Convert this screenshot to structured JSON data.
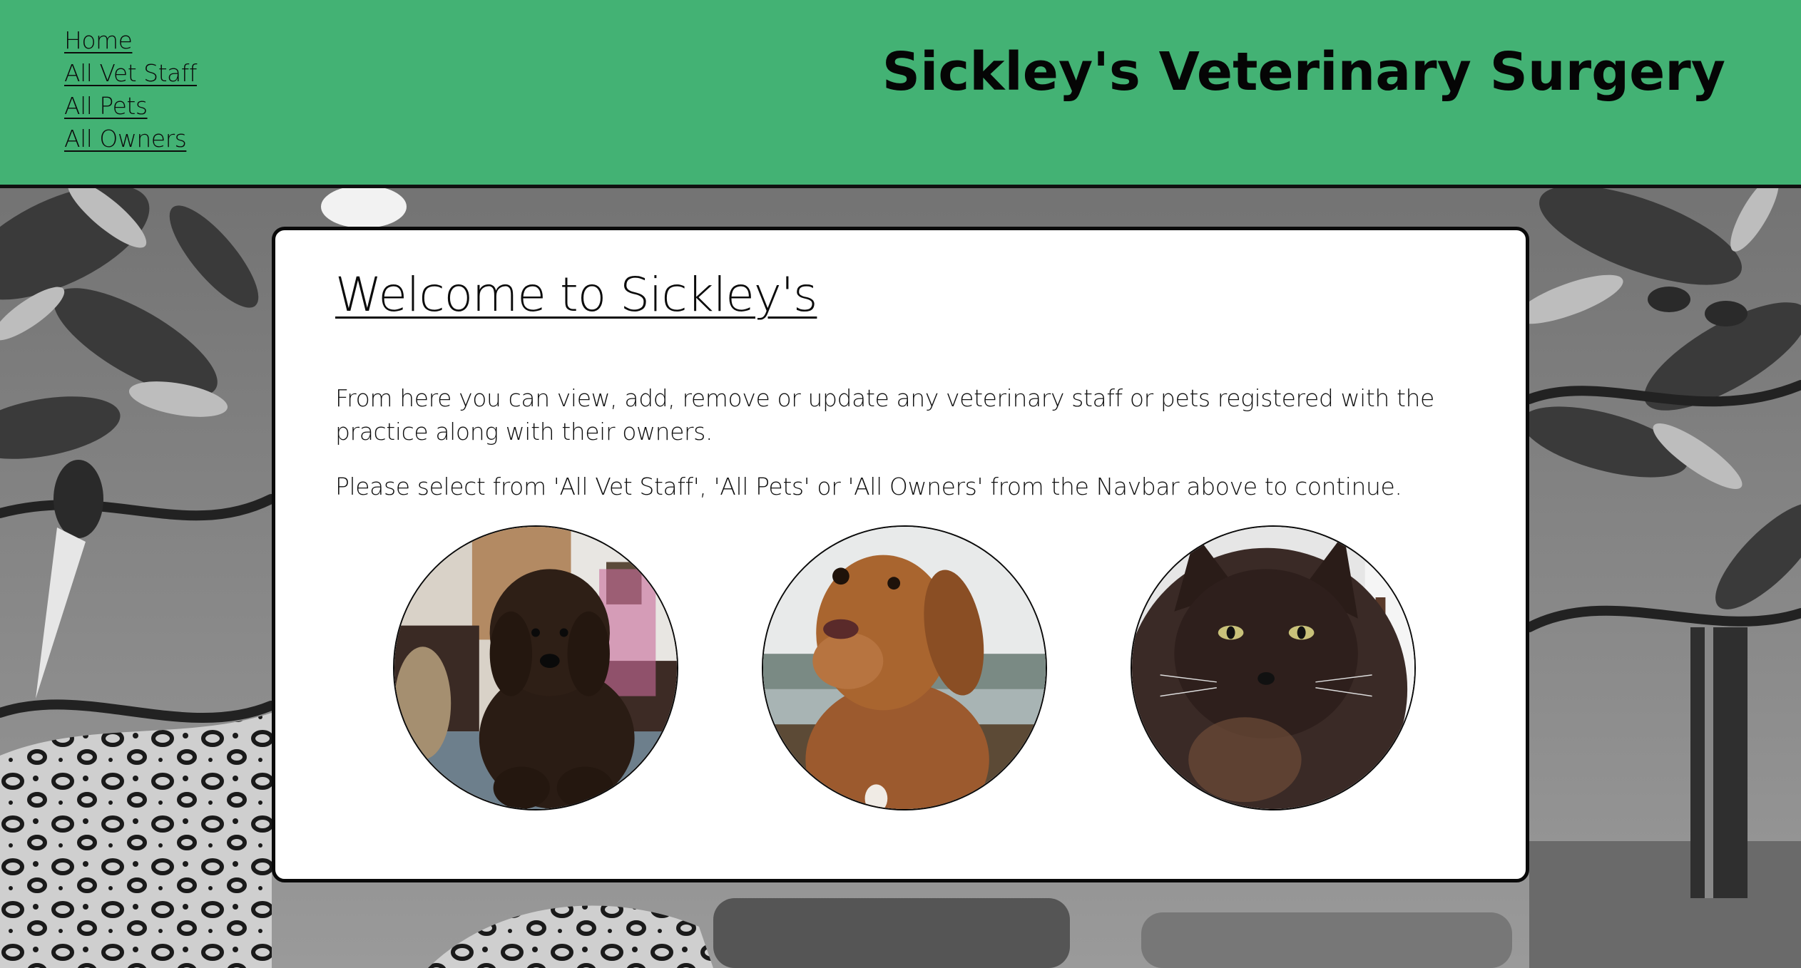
{
  "header": {
    "title": "Sickley's Veterinary Surgery",
    "background_color": "#43b274",
    "nav_items": [
      {
        "label": "Home"
      },
      {
        "label": "All Vet Staff"
      },
      {
        "label": "All Pets"
      },
      {
        "label": "All Owners"
      }
    ]
  },
  "main": {
    "heading": "Welcome to Sickley's",
    "intro": "From here you can view, add, remove or update any veterinary staff or pets registered with the practice along with their owners.",
    "instruction": "Please select from 'All Vet Staff', 'All Pets' or 'All Owners' from the Navbar above to continue.",
    "photos": [
      {
        "icon": "puppy-photo",
        "subject": "puppy"
      },
      {
        "icon": "dog-photo",
        "subject": "dog"
      },
      {
        "icon": "cat-photo",
        "subject": "cat"
      }
    ]
  },
  "background": {
    "icon": "jungle-illustration",
    "style": "grayscale"
  }
}
